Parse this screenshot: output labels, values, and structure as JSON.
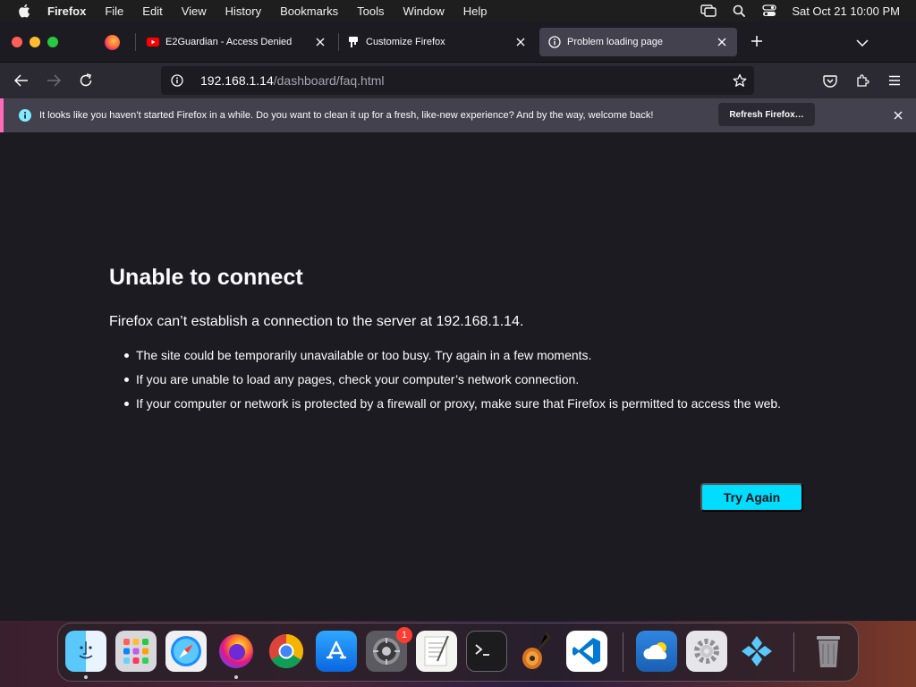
{
  "menubar": {
    "app_name": "Firefox",
    "items": [
      "File",
      "Edit",
      "View",
      "History",
      "Bookmarks",
      "Tools",
      "Window",
      "Help"
    ],
    "clock": "Sat Oct 21  10:00 PM"
  },
  "tabs": [
    {
      "title": "E2Guardian - Access Denied",
      "favicon": "youtube-icon",
      "active": false
    },
    {
      "title": "Customize Firefox",
      "favicon": "pin-icon",
      "active": false
    },
    {
      "title": "Problem loading page",
      "favicon": "info-icon",
      "active": true
    }
  ],
  "urlbar": {
    "host": "192.168.1.14",
    "path": "/dashboard/faq.html"
  },
  "notification": {
    "message": "It looks like you haven’t started Firefox in a while. Do you want to clean it up for a fresh, like-new experience? And by the way, welcome back!",
    "button": "Refresh Firefox…"
  },
  "error_page": {
    "title": "Unable to connect",
    "subtitle": "Firefox can’t establish a connection to the server at 192.168.1.14.",
    "bullets": [
      "The site could be temporarily unavailable or too busy. Try again in a few moments.",
      "If you are unable to load any pages, check your computer’s network connection.",
      "If your computer or network is protected by a firewall or proxy, make sure that Firefox is permitted to access the web."
    ],
    "try_again": "Try Again"
  },
  "dock": {
    "apps": [
      "finder",
      "launchpad",
      "safari",
      "firefox",
      "chrome",
      "app-store",
      "system-preferences",
      "textedit",
      "terminal",
      "garageband",
      "vscode",
      "weather",
      "settings",
      "ppsspp",
      "trash"
    ],
    "system_preferences_badge": "1"
  },
  "colors": {
    "accent": "#00ddff",
    "notice_stripe": "#ff6bba",
    "background": "#1c1b22"
  }
}
